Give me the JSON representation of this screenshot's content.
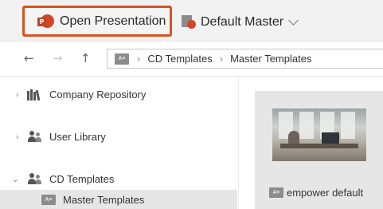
{
  "toolbar": {
    "open_label": "Open Presentation",
    "master_label": "Default Master"
  },
  "nav": {
    "breadcrumbs": [
      "CD Templates",
      "Master Templates"
    ]
  },
  "sidebar": {
    "items": [
      {
        "label": "Company Repository",
        "expander": "›",
        "icon": "books-icon"
      },
      {
        "label": "User Library",
        "expander": "›",
        "icon": "users-icon"
      },
      {
        "label": "CD Templates",
        "expander": "⌄",
        "icon": "shared-folder-icon"
      },
      {
        "label": "Master Templates",
        "expander": "",
        "icon": "template-folder-icon",
        "selected": true
      }
    ]
  },
  "content": {
    "tiles": [
      {
        "label": "empower default"
      }
    ]
  },
  "colors": {
    "accent": "#d9531e",
    "selection": "#e6e6e6",
    "toolbar_bg": "#f2f2f2"
  }
}
